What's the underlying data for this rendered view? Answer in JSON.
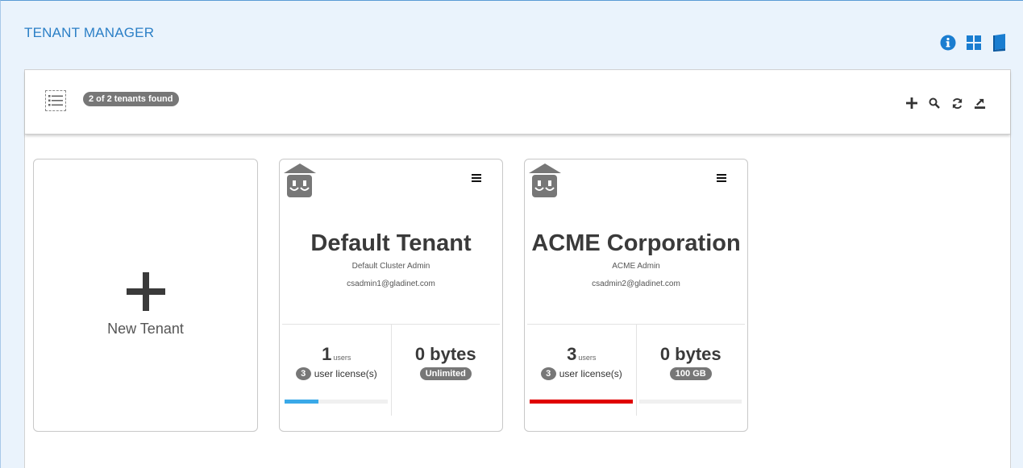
{
  "page": {
    "title": "TENANT MANAGER"
  },
  "top_icons": [
    {
      "icon": "info-icon",
      "color": "#1a7dd0"
    },
    {
      "icon": "grid-view-icon",
      "color": "#1a7dd0"
    },
    {
      "icon": "book-icon",
      "color": "#1a7dd0"
    }
  ],
  "toolbar": {
    "count_label": "2 of 2 tenants found",
    "actions": [
      "add-icon",
      "search-icon",
      "refresh-icon",
      "export-icon"
    ]
  },
  "new_tenant": {
    "label": "New Tenant"
  },
  "tenants": [
    {
      "name": "Default Tenant",
      "admin": "Default Cluster Admin",
      "email": "csadmin1@gladinet.com",
      "users": "1",
      "users_unit": "users",
      "licenses": "3",
      "license_label": "user license(s)",
      "storage": "0 bytes",
      "quota": "Unlimited",
      "license_usage": 0.33,
      "license_bar_color": "#3aa9e8",
      "storage_usage": 0
    },
    {
      "name": "ACME Corporation",
      "admin": "ACME Admin",
      "email": "csadmin2@gladinet.com",
      "users": "3",
      "users_unit": "users",
      "licenses": "3",
      "license_label": "user license(s)",
      "storage": "0 bytes",
      "quota": "100 GB",
      "license_usage": 1.0,
      "license_bar_color": "#e00000",
      "storage_usage": 0
    }
  ]
}
